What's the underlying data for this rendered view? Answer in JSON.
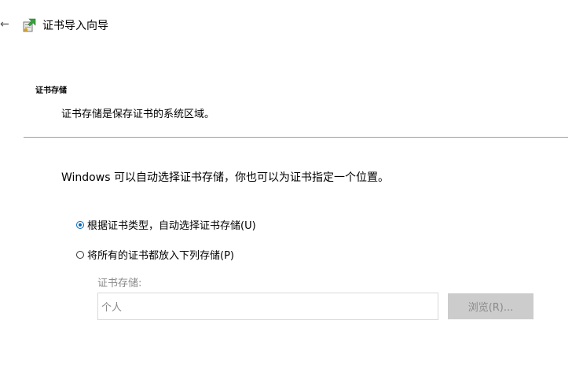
{
  "window": {
    "title": "证书导入向导"
  },
  "section": {
    "heading": "证书存储",
    "description": "证书存储是保存证书的系统区域。"
  },
  "info": "Windows 可以自动选择证书存储，你也可以为证书指定一个位置。",
  "options": {
    "auto": {
      "label": "根据证书类型，自动选择证书存储(U)",
      "checked": true
    },
    "manual": {
      "label": "将所有的证书都放入下列存储(P)",
      "checked": false
    }
  },
  "store": {
    "label": "证书存储:",
    "value": "个人"
  },
  "buttons": {
    "browse": "浏览(R)..."
  },
  "colors": {
    "accent": "#0067c0",
    "disabled_text": "#8a8a8a",
    "disabled_button_bg": "#cccccc"
  }
}
